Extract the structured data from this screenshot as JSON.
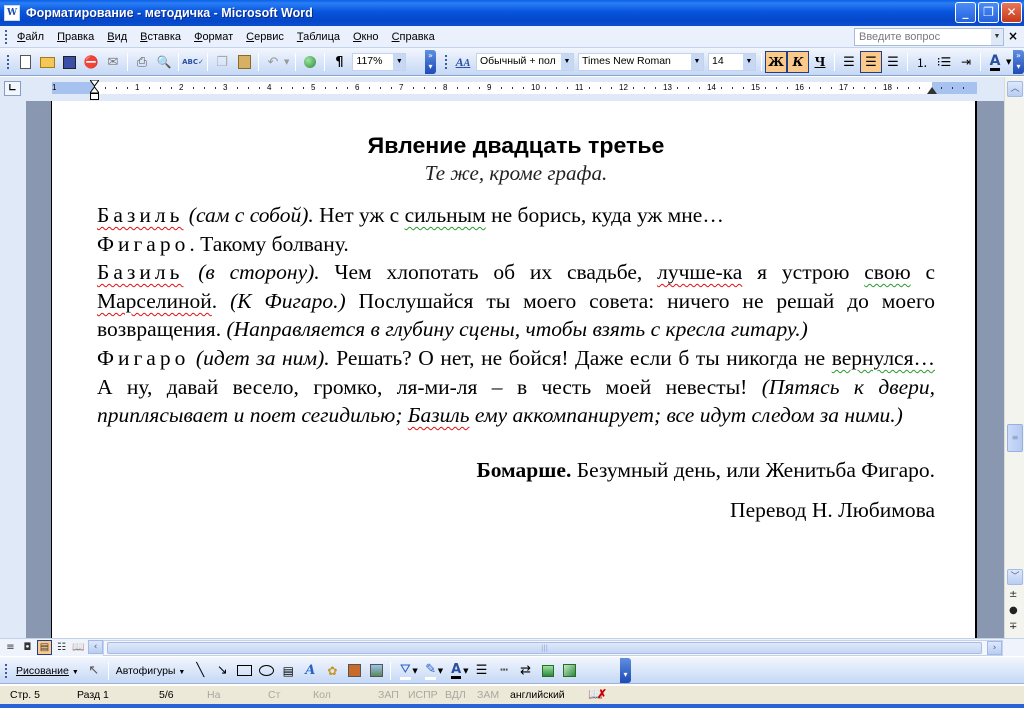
{
  "window": {
    "title": "Форматирование - методичка - Microsoft Word",
    "app_icon": "word-icon",
    "controls": {
      "minimize": "_",
      "restore": "❐",
      "close": "✕"
    }
  },
  "menubar": {
    "items": [
      "Файл",
      "Правка",
      "Вид",
      "Вставка",
      "Формат",
      "Сервис",
      "Таблица",
      "Окно",
      "Справка"
    ],
    "ask_placeholder": "Введите вопрос",
    "close_doc": "×"
  },
  "standard_toolbar": {
    "buttons": [
      "new-document",
      "open",
      "save",
      "permission",
      "email",
      "print",
      "print-preview",
      "spelling",
      "copy",
      "paste",
      "undo",
      "hyperlink",
      "show-formatting"
    ],
    "zoom": "117%"
  },
  "formatting_toolbar": {
    "style": "Обычный + пол",
    "font": "Times New Roman",
    "size": "14",
    "bold_label": "Ж",
    "italic_label": "К",
    "underline_label": "Ч",
    "bold_active": true,
    "italic_active": true,
    "underline_active": false,
    "alignment": "center",
    "font_color": "#000000"
  },
  "ruler": {
    "unit": "cm",
    "labels": [
      "1",
      "1",
      "2",
      "3",
      "4",
      "5",
      "6",
      "7",
      "8",
      "9",
      "10",
      "11",
      "12",
      "13",
      "14",
      "15",
      "16",
      "17",
      "18"
    ]
  },
  "document": {
    "heading": "Явление двадцать третье",
    "subheading": "Те же, кроме графа.",
    "p1": {
      "speaker": "Базиль",
      "stage": "(сам с собой).",
      "text_a": " Нет уж с ",
      "text_b": "сильным",
      "text_c": " не борись, куда уж мне…"
    },
    "p2": {
      "speaker": "Фигаро",
      "text": ". Такому болвану."
    },
    "p3": {
      "speaker": "Базиль",
      "stage": "(в сторону).",
      "text_a": " Чем хлопотать об их свадьбе, ",
      "text_b": "лучше-ка",
      "text_c": " я устрою ",
      "text_d": "свою",
      "text_e": " с ",
      "text_f": "Марселиной",
      "text_g": ". ",
      "stage2": "(К Фигаро.)",
      "text_h": " Послушайся ты моего совета: ничего не решай до моего возвращения. ",
      "stage3": "(Направляется в глубину сцены, чтобы взять с кресла гитару.)"
    },
    "p4": {
      "speaker": "Фигаро",
      "stage": "(идет за ним).",
      "text_a": " Решать? О нет, не бойся! Даже если б ты никогда не ",
      "text_b": "вернулся…",
      "text_c": " А ну, давай весело, громко, ля-ми-ля – в честь моей невесты! ",
      "stage2a": "(Пятясь к двери, приплясывает и поет сегидилью; ",
      "stage2b": "Базиль",
      "stage2c": " ему аккомпанирует; все идут следом за ними.)"
    },
    "source_author": "Бомарше.",
    "source_title": " Безумный день, или Женитьба Фигаро.",
    "translator": "Перевод Н. Любимова"
  },
  "view_buttons": [
    "normal-view",
    "web-layout",
    "print-layout",
    "outline-view",
    "reading-layout"
  ],
  "drawing_toolbar": {
    "drawing_label": "Рисование",
    "autoshapes_label": "Автофигуры"
  },
  "statusbar": {
    "page": "Стр. 5",
    "section": "Разд 1",
    "pages": "5/6",
    "at": "На",
    "line": "Ст",
    "col": "Кол",
    "rec": "ЗАП",
    "trk": "ИСПР",
    "ext": "ВДЛ",
    "ovr": "ЗАМ",
    "language": "английский"
  }
}
